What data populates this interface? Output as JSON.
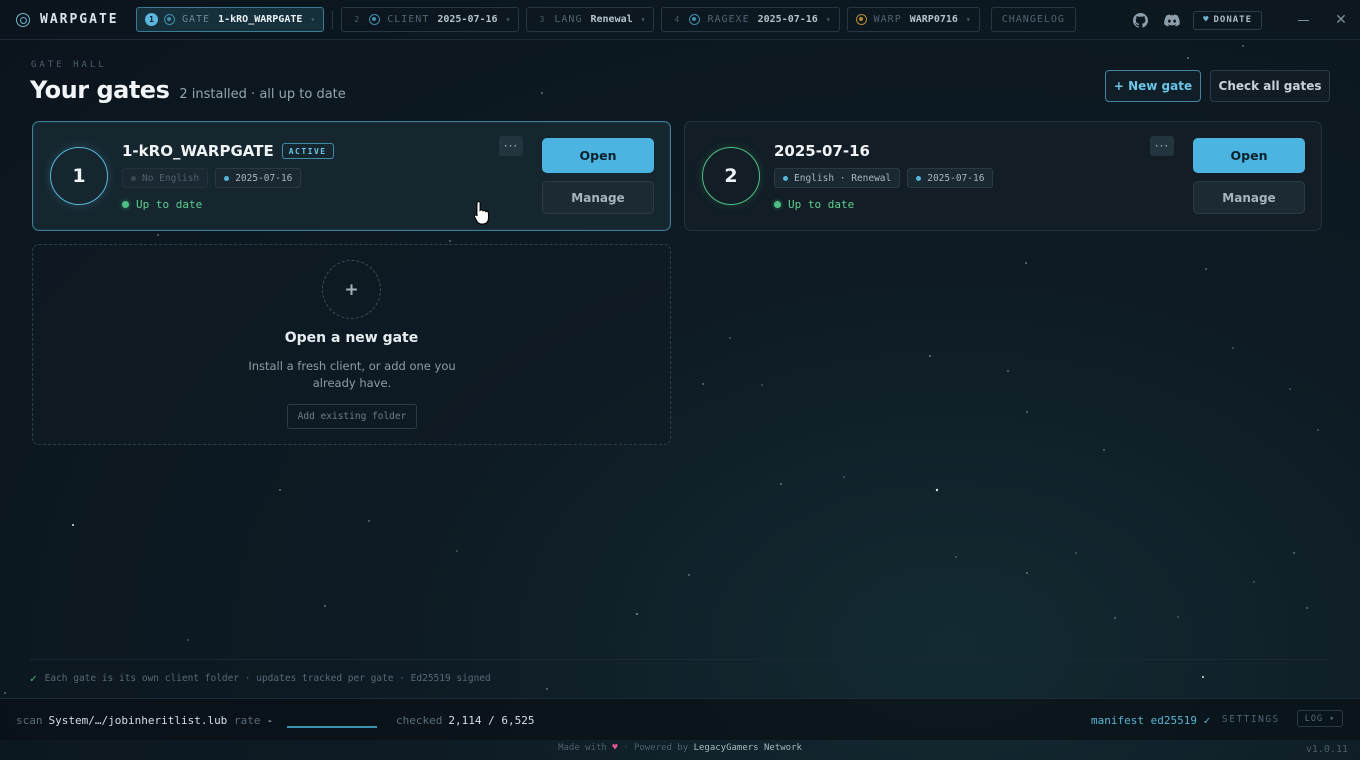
{
  "app": {
    "title": "WARPGATE"
  },
  "steps": [
    {
      "num": "1",
      "key": "GATE",
      "value": "1-kRO_WARPGATE",
      "active": true
    },
    {
      "num": "2",
      "key": "CLIENT",
      "value": "2025-07-16"
    },
    {
      "num": "3",
      "key": "LANG",
      "value": "Renewal"
    },
    {
      "num": "4",
      "key": "RAGEXE",
      "value": "2025-07-16"
    },
    {
      "num": "",
      "key": "WARP",
      "value": "WARP0716"
    }
  ],
  "toolbar": {
    "changelog": "CHANGELOG",
    "donate": "DONATE"
  },
  "header": {
    "kicker": "GATE HALL",
    "title": "Your gates",
    "subtitle": "2 installed · all up to date",
    "new_gate": "+ New gate",
    "check_all": "Check all gates"
  },
  "gates": [
    {
      "index": "1",
      "name": "1-kRO_WARPGATE",
      "badge": "ACTIVE",
      "tags": [
        "No English",
        "2025-07-16"
      ],
      "status": "Up to date",
      "open": "Open",
      "manage": "Manage"
    },
    {
      "index": "2",
      "name": "2025-07-16",
      "tags": [
        "English · Renewal",
        "2025-07-16"
      ],
      "status": "Up to date",
      "open": "Open",
      "manage": "Manage"
    }
  ],
  "new_gate_card": {
    "plus": "+",
    "title": "Open a new gate",
    "description": "Install a fresh client, or add one you already have.",
    "add_existing": "Add existing folder"
  },
  "footer": {
    "note": "Each gate is its own client folder · updates tracked per gate · Ed25519 signed"
  },
  "statusbar": {
    "scan_label": "scan",
    "scan_value": "System/…/jobinheritlist.lub",
    "rate_label": "rate",
    "rate_value": "-",
    "checked_label": "checked",
    "checked_value": "2,114 / 6,525",
    "manifest": "manifest ed25519 ✓",
    "settings": "SETTINGS",
    "log": "LOG ▾"
  },
  "credits": {
    "made_with": "Made with",
    "heart": "♥",
    "powered": "· Powered by",
    "org": "LegacyGamers Network",
    "version": "v1.0.11"
  },
  "colors": {
    "accent": "#4cb4e0",
    "success": "#4dbf84",
    "background": "#0b141c"
  }
}
